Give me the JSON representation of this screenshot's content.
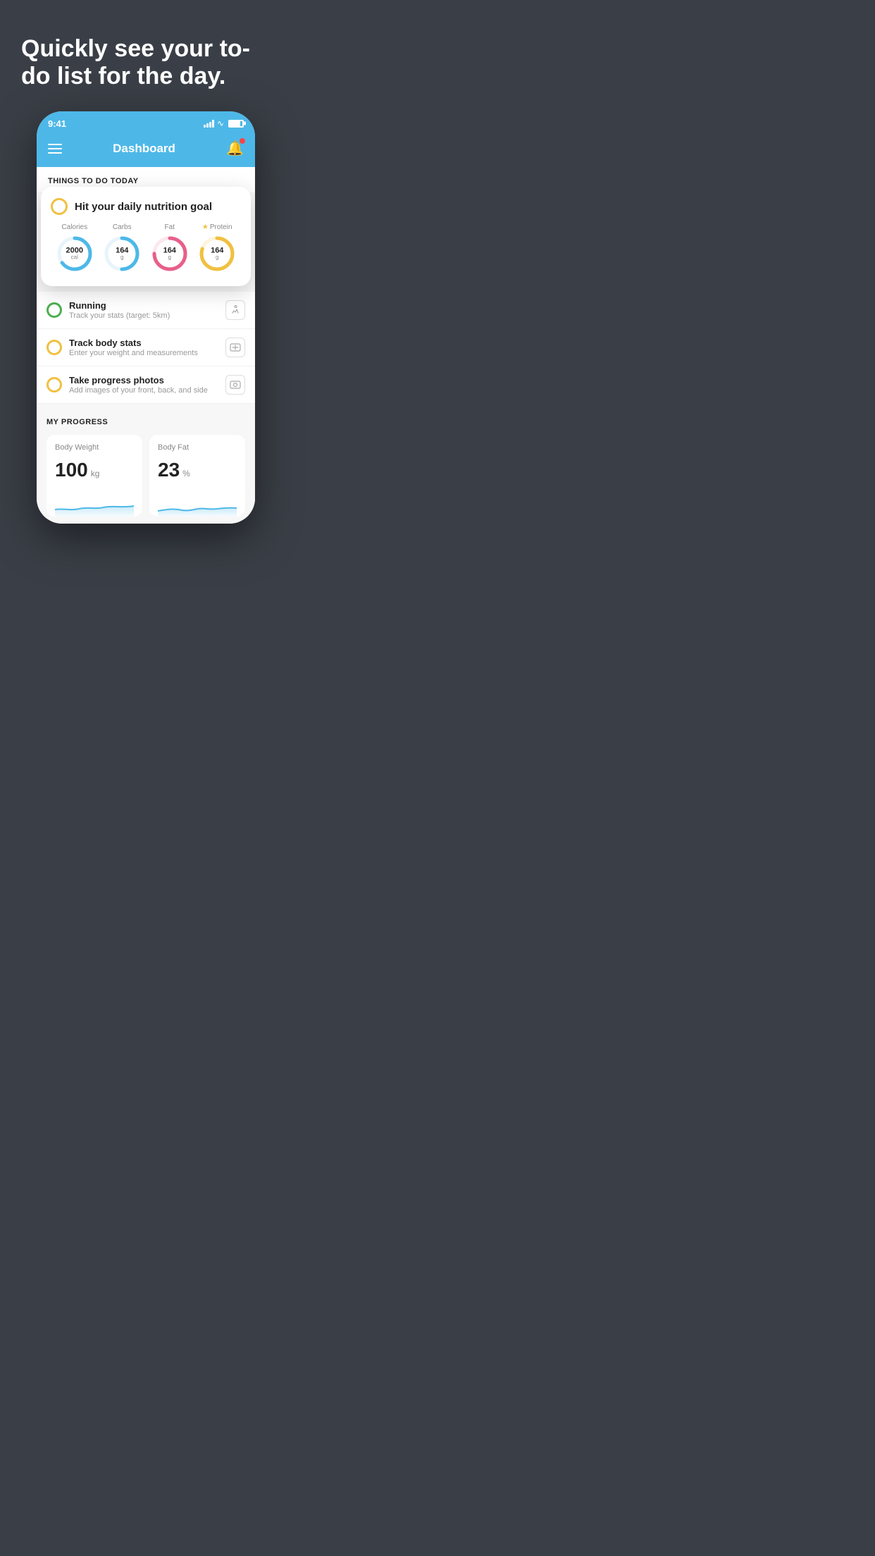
{
  "hero": {
    "title": "Quickly see your to-do list for the day."
  },
  "status_bar": {
    "time": "9:41"
  },
  "header": {
    "title": "Dashboard"
  },
  "things_section": {
    "title": "THINGS TO DO TODAY"
  },
  "nutrition_card": {
    "circle_color": "#f0c040",
    "title": "Hit your daily nutrition goal",
    "calories": {
      "label": "Calories",
      "value": "2000",
      "unit": "cal",
      "color": "#4db8e8",
      "percent": 65
    },
    "carbs": {
      "label": "Carbs",
      "value": "164",
      "unit": "g",
      "color": "#4db8e8",
      "percent": 50
    },
    "fat": {
      "label": "Fat",
      "value": "164",
      "unit": "g",
      "color": "#e85f8a",
      "percent": 75
    },
    "protein": {
      "label": "Protein",
      "value": "164",
      "unit": "g",
      "color": "#f0c040",
      "percent": 80,
      "starred": true
    }
  },
  "todo_items": [
    {
      "id": "running",
      "circle_color": "green",
      "main": "Running",
      "sub": "Track your stats (target: 5km)",
      "icon": "👟"
    },
    {
      "id": "body-stats",
      "circle_color": "yellow",
      "main": "Track body stats",
      "sub": "Enter your weight and measurements",
      "icon": "⚖"
    },
    {
      "id": "progress-photos",
      "circle_color": "yellow",
      "main": "Take progress photos",
      "sub": "Add images of your front, back, and side",
      "icon": "🖼"
    }
  ],
  "progress_section": {
    "title": "MY PROGRESS",
    "cards": [
      {
        "id": "body-weight",
        "title": "Body Weight",
        "value": "100",
        "unit": "kg"
      },
      {
        "id": "body-fat",
        "title": "Body Fat",
        "value": "23",
        "unit": "%"
      }
    ]
  }
}
